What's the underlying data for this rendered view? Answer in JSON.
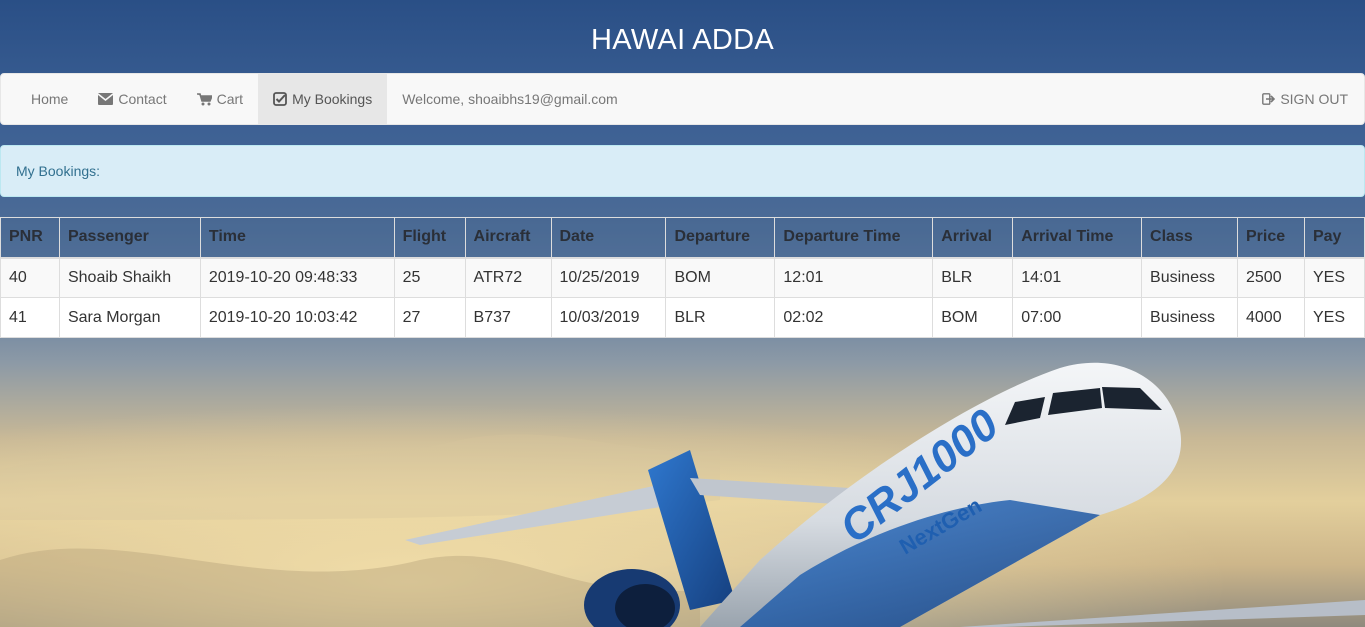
{
  "header": {
    "title": "HAWAI ADDA"
  },
  "nav": {
    "items": [
      {
        "label": "Home",
        "icon": "none"
      },
      {
        "label": "Contact",
        "icon": "envelope-icon"
      },
      {
        "label": "Cart",
        "icon": "cart-icon"
      },
      {
        "label": "My Bookings",
        "icon": "check-square-icon",
        "active": true
      }
    ],
    "welcome": "Welcome, shoaibhs19@gmail.com",
    "signout": "SIGN OUT"
  },
  "alert": {
    "text": "My Bookings:"
  },
  "table": {
    "headers": [
      "PNR",
      "Passenger",
      "Time",
      "Flight",
      "Aircraft",
      "Date",
      "Departure",
      "Departure Time",
      "Arrival",
      "Arrival Time",
      "Class",
      "Price",
      "Pay"
    ],
    "rows": [
      [
        "40",
        "Shoaib Shaikh",
        "2019-10-20 09:48:33",
        "25",
        "ATR72",
        "10/25/2019",
        "BOM",
        "12:01",
        "BLR",
        "14:01",
        "Business",
        "2500",
        "YES"
      ],
      [
        "41",
        "Sara Morgan",
        "2019-10-20 10:03:42",
        "27",
        "B737",
        "10/03/2019",
        "BLR",
        "02:02",
        "BOM",
        "07:00",
        "Business",
        "4000",
        "YES"
      ]
    ]
  },
  "background": {
    "livery_text": "CRJ1000",
    "livery_subtext": "NextGen",
    "colors": {
      "sky_top": "#2a4f86",
      "sky_glow": "#e3cf9c",
      "livery_blue": "#1f5fb0",
      "fuselage": "#e8ecf0"
    }
  }
}
